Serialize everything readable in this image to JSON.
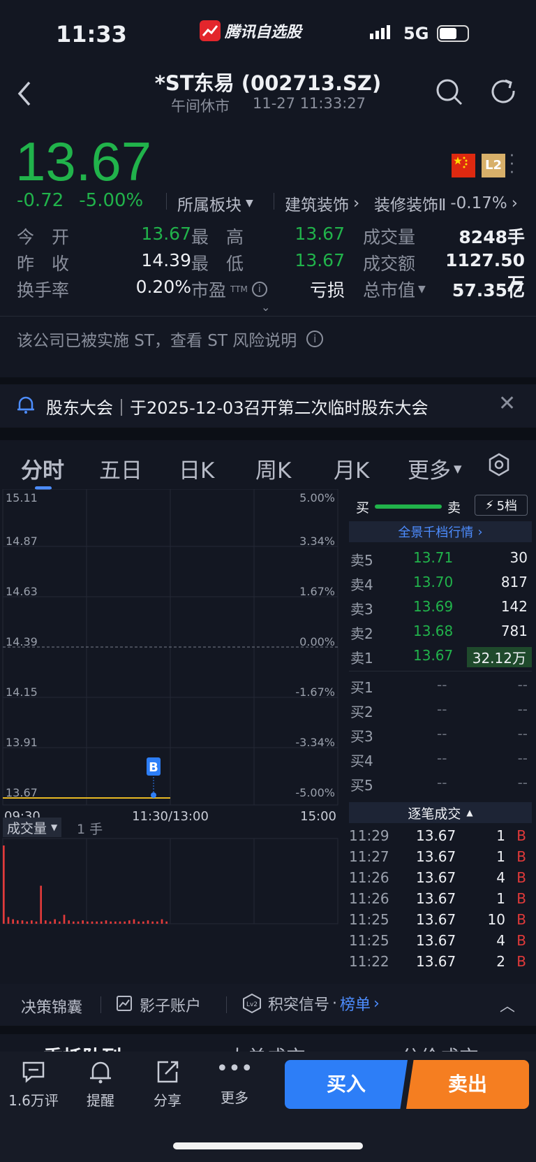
{
  "status_bar": {
    "time": "11:33",
    "app_name": "腾讯自选股",
    "network": "5G"
  },
  "header": {
    "title": "*ST东易 (002713.SZ)",
    "status": "午间休市",
    "datetime": "11-27 11:33:27"
  },
  "quote": {
    "price": "13.67",
    "change": "-0.72",
    "change_pct": "-5.00%",
    "sector_label": "所属板块",
    "sector_1": "建筑装饰",
    "sector_2": "装修装饰Ⅱ",
    "sector_2_pct": "-0.17%",
    "badge_l2": "L2",
    "stats": {
      "open_label": "今　开",
      "open": "13.67",
      "high_label": "最　高",
      "high": "13.67",
      "volume_label": "成交量",
      "volume": "8248手",
      "prev_close_label": "昨　收",
      "prev_close": "14.39",
      "low_label": "最　低",
      "low": "13.67",
      "amount_label": "成交额",
      "amount": "1127.50万",
      "turnover_label": "换手率",
      "turnover": "0.20%",
      "pe_label": "市盈",
      "pe_sup": "TTM",
      "pe": "亏损",
      "mcap_label": "总市值",
      "mcap": "57.35亿"
    },
    "st_notice": "该公司已被实施 ST，查看 ST 风险说明"
  },
  "announcement": {
    "text": "股东大会｜于2025-12-03召开第二次临时股东大会"
  },
  "tabs": [
    "分时",
    "五日",
    "日K",
    "周K",
    "月K",
    "更多"
  ],
  "chart_data": {
    "type": "line",
    "title": "",
    "x_labels": [
      "09:30",
      "11:30/13:00",
      "15:00"
    ],
    "y_left_ticks": [
      "15.11",
      "14.87",
      "14.63",
      "14.39",
      "14.15",
      "13.91",
      "13.67"
    ],
    "y_right_ticks": [
      "5.00%",
      "3.34%",
      "1.67%",
      "0.00%",
      "-1.67%",
      "-3.34%",
      "-5.00%"
    ],
    "ylim": [
      13.67,
      15.11
    ],
    "prev_close": 14.39,
    "series": [
      {
        "values": [
          13.67,
          13.67,
          13.67,
          13.67,
          13.67
        ]
      }
    ],
    "x_session_fraction": 0.5,
    "marker": "B",
    "volume_label": "成交量",
    "volume_unit": "1 手",
    "volume_bars": [
      70,
      6,
      4,
      3,
      3,
      2,
      3,
      2,
      34,
      3,
      2,
      4,
      2,
      8,
      3,
      2,
      2,
      3,
      2,
      2,
      2,
      2,
      3,
      2,
      2,
      2,
      2,
      3,
      4,
      2,
      2,
      3,
      2,
      2,
      4,
      2
    ]
  },
  "orderbook": {
    "buy_label": "买",
    "sell_label": "卖",
    "levels_btn": "5档",
    "full_depth": "全景千档行情",
    "asks": [
      {
        "label": "卖5",
        "price": "13.71",
        "vol": "30"
      },
      {
        "label": "卖4",
        "price": "13.70",
        "vol": "817"
      },
      {
        "label": "卖3",
        "price": "13.69",
        "vol": "142"
      },
      {
        "label": "卖2",
        "price": "13.68",
        "vol": "781"
      },
      {
        "label": "卖1",
        "price": "13.67",
        "vol": "32.12万"
      }
    ],
    "bids": [
      {
        "label": "买1",
        "price": "--",
        "vol": "--"
      },
      {
        "label": "买2",
        "price": "--",
        "vol": "--"
      },
      {
        "label": "买3",
        "price": "--",
        "vol": "--"
      },
      {
        "label": "买4",
        "price": "--",
        "vol": "--"
      },
      {
        "label": "买5",
        "price": "--",
        "vol": "--"
      }
    ],
    "trades_title": "逐笔成交",
    "trades": [
      {
        "time": "11:29",
        "price": "13.67",
        "vol": "1",
        "side": "B"
      },
      {
        "time": "11:27",
        "price": "13.67",
        "vol": "1",
        "side": "B"
      },
      {
        "time": "11:26",
        "price": "13.67",
        "vol": "4",
        "side": "B"
      },
      {
        "time": "11:26",
        "price": "13.67",
        "vol": "1",
        "side": "B"
      },
      {
        "time": "11:25",
        "price": "13.67",
        "vol": "10",
        "side": "B"
      },
      {
        "time": "11:25",
        "price": "13.67",
        "vol": "4",
        "side": "B"
      },
      {
        "time": "11:22",
        "price": "13.67",
        "vol": "2",
        "side": "B"
      }
    ]
  },
  "strip": {
    "item1": "决策锦囊",
    "item2": "影子账户",
    "item3": "积突信号",
    "item3_link": "榜单"
  },
  "partial_tabs": [
    "委托队列",
    "大单成交",
    "分价成交"
  ],
  "toolbar": {
    "comments": "1.6万评",
    "remind": "提醒",
    "share": "分享",
    "more": "更多",
    "buy": "买入",
    "sell": "卖出"
  }
}
